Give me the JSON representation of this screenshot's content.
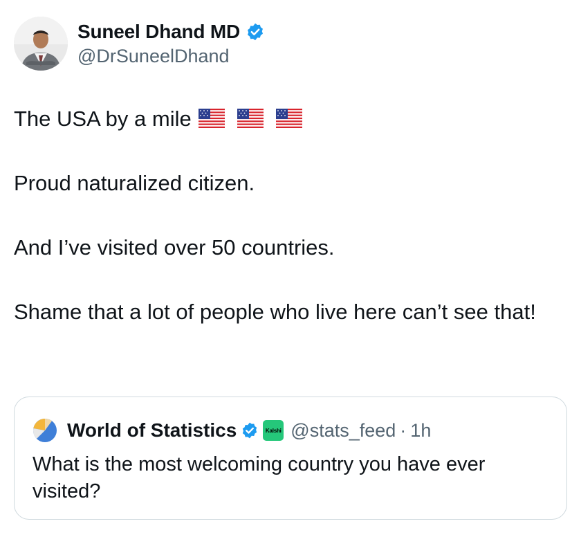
{
  "author": {
    "display_name": "Suneel Dhand MD",
    "handle": "@DrSuneelDhand",
    "verified": true
  },
  "tweet": {
    "paragraphs": [
      "The USA by a mile",
      "Proud naturalized citizen.",
      "And I’ve visited over 50 countries.",
      "Shame that a lot of people who live here can’t see that!"
    ],
    "emoji": [
      "us-flag-icon",
      "us-flag-icon",
      "us-flag-icon"
    ]
  },
  "quoted_tweet": {
    "display_name": "World of Statistics",
    "verified": true,
    "affiliate_badge": "Kalshi",
    "handle": "@stats_feed",
    "separator": "·",
    "time": "1h",
    "text": "What is the most welcoming country you have ever visited?"
  },
  "colors": {
    "text": "#0f1419",
    "secondary_text": "#536471",
    "verified_blue": "#1d9bf0",
    "border": "#cfd9de",
    "kalshi_green": "#25c77a"
  }
}
